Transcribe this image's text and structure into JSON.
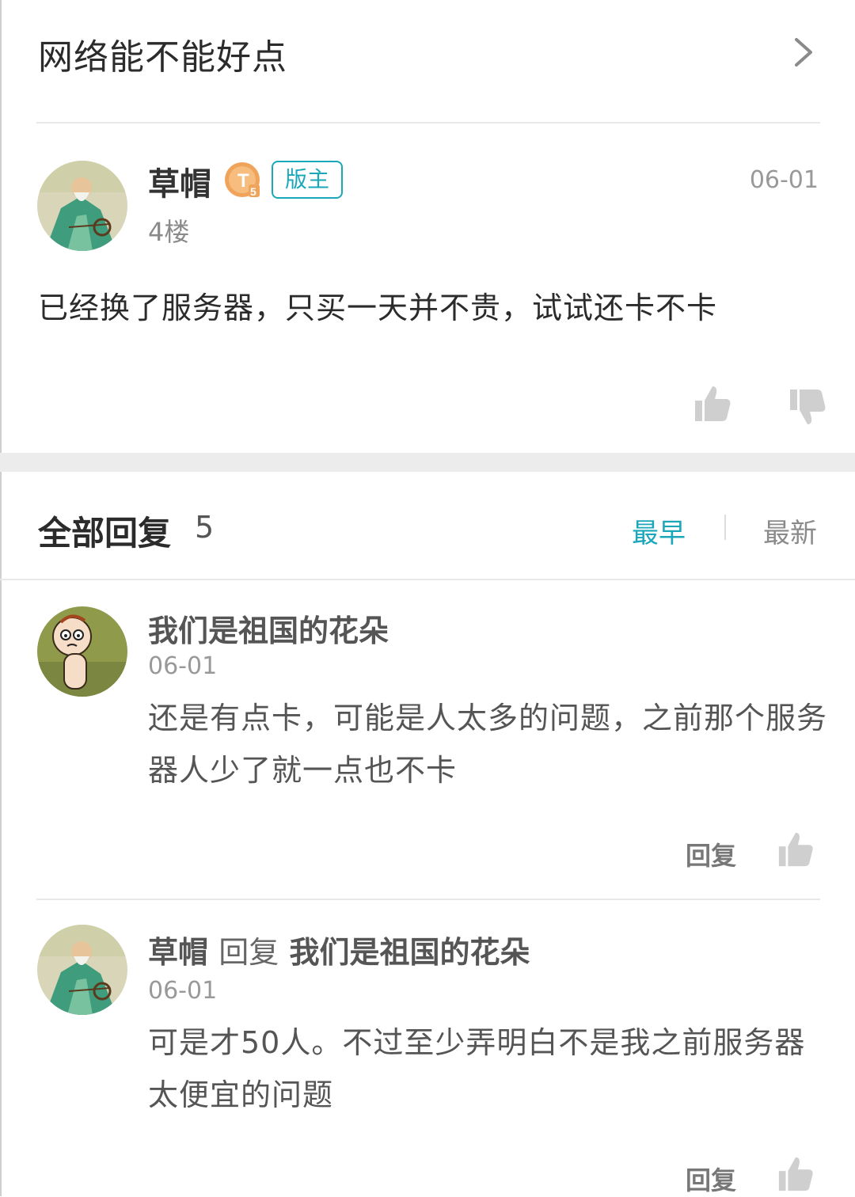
{
  "thread": {
    "title": "网络能不能好点"
  },
  "post": {
    "author": "草帽",
    "author_level_badge": "T5",
    "role_badge": "版主",
    "floor": "4楼",
    "date": "06-01",
    "content": "已经换了服务器，只买一天并不贵，试试还卡不卡"
  },
  "replies_header": {
    "title": "全部回复",
    "count": "5",
    "sort_earliest": "最早",
    "sort_latest": "最新"
  },
  "replies": [
    {
      "author": "我们是祖国的花朵",
      "date": "06-01",
      "content": "还是有点卡，可能是人太多的问题，之前那个服务器人少了就一点也不卡",
      "reply_label": "回复"
    },
    {
      "author": "草帽",
      "reply_word": "回复",
      "reply_to": "我们是祖国的花朵",
      "date": "06-01",
      "content": "可是才50人。不过至少弄明白不是我之前服务器太便宜的问题",
      "reply_label": "回复"
    }
  ],
  "colors": {
    "accent": "#1aa7ba",
    "text": "#333333",
    "muted": "#999999",
    "badge_gold": "#f0a35a"
  },
  "icons": [
    "chevron-right-icon",
    "thumbs-up-icon",
    "thumbs-down-icon",
    "t5-level-icon"
  ]
}
